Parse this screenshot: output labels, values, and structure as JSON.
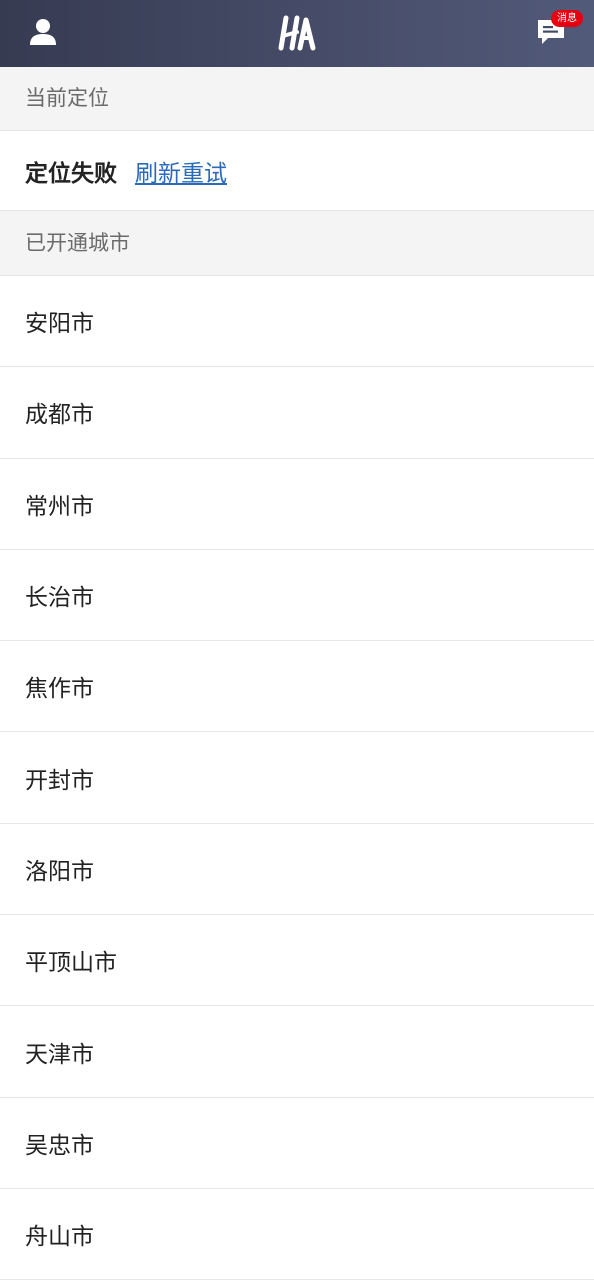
{
  "header": {
    "user_icon": "user-icon",
    "logo_text": "HA",
    "message_icon": "chat-bubble-icon",
    "message_badge": "消息",
    "background": "#454b66",
    "badge_color": "#e60012"
  },
  "current_location": {
    "section_title": "当前定位",
    "status": "定位失败",
    "retry_link": "刷新重试",
    "link_color": "#2a6ab8"
  },
  "cities": {
    "section_title": "已开通城市",
    "items": [
      "安阳市",
      "成都市",
      "常州市",
      "长治市",
      "焦作市",
      "开封市",
      "洛阳市",
      "平顶山市",
      "天津市",
      "吴忠市",
      "舟山市"
    ]
  }
}
